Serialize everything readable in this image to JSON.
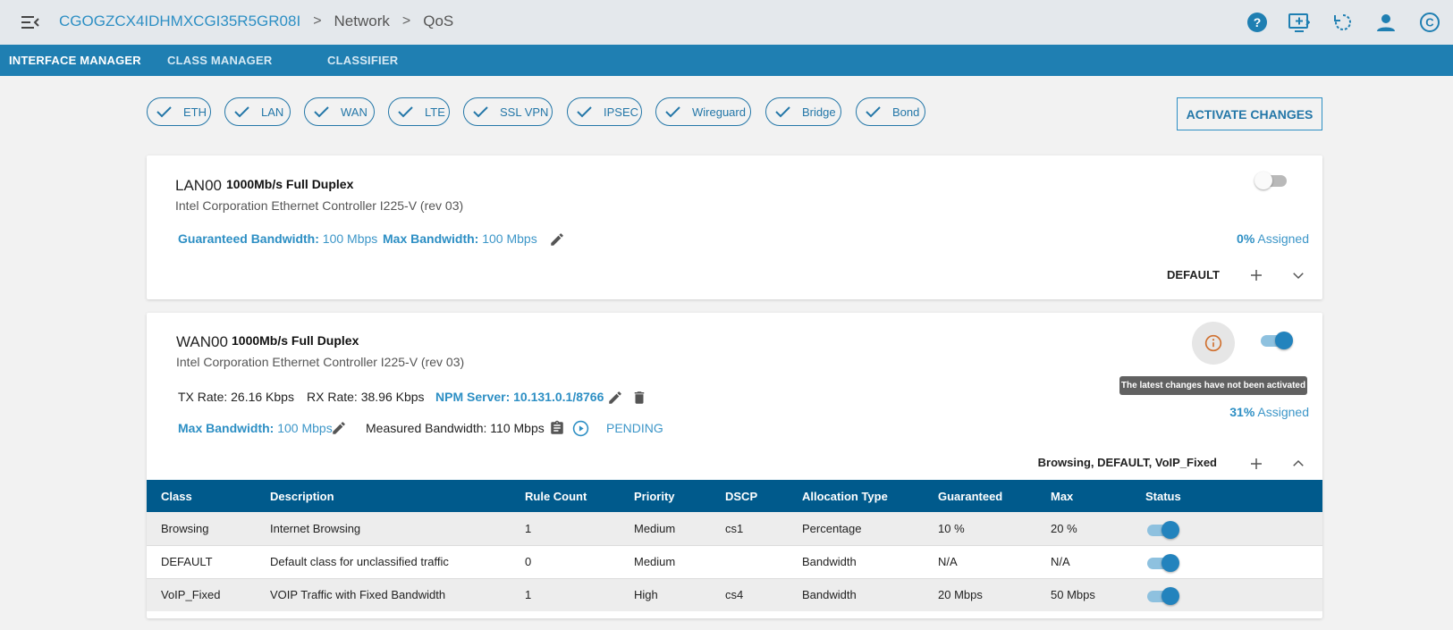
{
  "header": {
    "device": "CGOGZCX4IDHMXCGI35R5GR08I",
    "crumbs": [
      "Network",
      "QoS"
    ],
    "separator": ">",
    "icons": [
      "menu-collapse-icon",
      "help-icon",
      "remote-screen-icon",
      "refresh-icon",
      "user-icon",
      "copyright-icon"
    ]
  },
  "tabs": [
    "INTERFACE MANAGER",
    "CLASS MANAGER",
    "CLASSIFIER"
  ],
  "filters": [
    "ETH",
    "LAN",
    "WAN",
    "LTE",
    "SSL VPN",
    "IPSEC",
    "Wireguard",
    "Bridge",
    "Bond"
  ],
  "activate_label": "ACTIVATE CHANGES",
  "lan": {
    "name": "LAN00",
    "speed": "1000Mb/s Full Duplex",
    "desc": "Intel Corporation Ethernet Controller I225-V (rev 03)",
    "gb_label": "Guaranteed Bandwidth:",
    "gb_value": "100 Mbps",
    "mb_label": "Max Bandwidth:",
    "mb_value": "100 Mbps",
    "assigned_pct": "0%",
    "assigned_label": "Assigned",
    "classes": "DEFAULT",
    "enabled": false
  },
  "wan": {
    "name": "WAN00",
    "speed": "1000Mb/s Full Duplex",
    "desc": "Intel Corporation Ethernet Controller I225-V (rev 03)",
    "tx": "TX Rate: 26.16 Kbps",
    "rx": "RX Rate: 38.96 Kbps",
    "npm": "NPM Server: 10.131.0.1/8766",
    "mb_label": "Max Bandwidth:",
    "mb_value": "100 Mbps",
    "measured": "Measured Bandwidth: 110 Mbps",
    "pending": "PENDING",
    "tooltip": "The latest changes have not been activated",
    "assigned_pct": "31%",
    "assigned_label": "Assigned",
    "classes": "Browsing, DEFAULT, VoIP_Fixed",
    "enabled": true
  },
  "table": {
    "headers": [
      "Class",
      "Description",
      "Rule Count",
      "Priority",
      "DSCP",
      "Allocation Type",
      "Guaranteed",
      "Max",
      "Status"
    ],
    "rows": [
      {
        "class": "Browsing",
        "description": "Internet Browsing",
        "rule_count": "1",
        "priority": "Medium",
        "dscp": "cs1",
        "allocation": "Percentage",
        "guaranteed": "10 %",
        "max": "20 %",
        "status": true
      },
      {
        "class": "DEFAULT",
        "description": "Default class for unclassified traffic",
        "rule_count": "0",
        "priority": "Medium",
        "dscp": "",
        "allocation": "Bandwidth",
        "guaranteed": "N/A",
        "max": "N/A",
        "status": true
      },
      {
        "class": "VoIP_Fixed",
        "description": "VOIP Traffic with Fixed Bandwidth",
        "rule_count": "1",
        "priority": "High",
        "dscp": "cs4",
        "allocation": "Bandwidth",
        "guaranteed": "20 Mbps",
        "max": "50 Mbps",
        "status": true
      }
    ]
  },
  "colors": {
    "primary": "#1f7fb2",
    "table_header": "#005a8c",
    "accent": "#2d8fc4",
    "warning": "#d0702f"
  }
}
